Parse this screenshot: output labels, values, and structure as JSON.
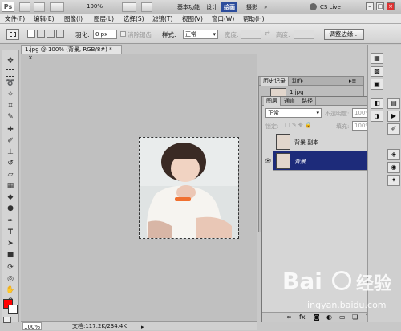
{
  "appbar": {
    "logo": "Ps",
    "zoom": "100%",
    "workspaces": [
      "基本功能",
      "设计",
      "绘画",
      "摄影"
    ],
    "more": "»",
    "cslive": "CS Live",
    "win_min": "–",
    "win_max": "□",
    "win_close": "×"
  },
  "menu": [
    "文件(F)",
    "编辑(E)",
    "图像(I)",
    "图层(L)",
    "选择(S)",
    "滤镜(T)",
    "视图(V)",
    "窗口(W)",
    "帮助(H)"
  ],
  "options": {
    "feather_label": "羽化:",
    "feather_value": "0 px",
    "antialias_label": "消除锯齿",
    "style_label": "样式:",
    "style_value": "正常",
    "width_label": "宽度:",
    "height_label": "高度:",
    "refine_button": "调整边缘..."
  },
  "document": {
    "tab_title": "1.jpg @ 100% (背景, RGB/8#) *",
    "close": "×",
    "status_zoom": "100%",
    "status_doc": "文档:117.2K/234.4K"
  },
  "history": {
    "tabs": [
      "历史记录",
      "动作"
    ],
    "item": "1.jpg"
  },
  "layers": {
    "tabs": [
      "图层",
      "通道",
      "路径"
    ],
    "blend_mode": "正常",
    "opacity_label": "不透明度:",
    "opacity_value": "100%",
    "lock_label": "锁定:",
    "fill_label": "填充:",
    "fill_value": "100%",
    "rows": [
      {
        "name": "背景 副本"
      },
      {
        "name": "背景"
      }
    ]
  },
  "watermark": {
    "brand": "Bai",
    "brand2": "经验",
    "url": "jingyan.baidu.com"
  },
  "colors": {
    "foreground": "#ff0000",
    "background": "#ffffff",
    "selected_layer": "#1d2b7a",
    "paint_workspace": "#2b4c9c"
  }
}
